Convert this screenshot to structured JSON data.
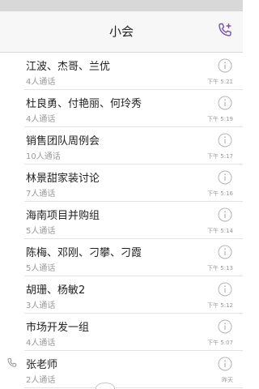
{
  "header": {
    "title": "小会"
  },
  "icons": {
    "new_call": "phone-plus-icon",
    "info": "info-circle-icon",
    "phone": "phone-icon"
  },
  "colors": {
    "accent": "#7b4fa6",
    "icon_gray": "#b5b5b5"
  },
  "calls": [
    {
      "title": "江波、杰哥、兰优",
      "sub": "4人通话",
      "time": "下午 5:21"
    },
    {
      "title": "杜良勇、付艳丽、何玲秀",
      "sub": "4人通话",
      "time": "下午 5:19"
    },
    {
      "title": "销售团队周例会",
      "sub": "10人通话",
      "time": "下午 5:17"
    },
    {
      "title": "林景甜家装讨论",
      "sub": "7人通话",
      "time": "下午 5:16"
    },
    {
      "title": "海南项目并购组",
      "sub": "5人通话",
      "time": "下午 5:14"
    },
    {
      "title": "陈梅、邓刚、刁攀、刁霞",
      "sub": "5人通话",
      "time": "下午 5:13"
    },
    {
      "title": "胡珊、杨敏2",
      "sub": "3人通话",
      "time": "下午 5:12"
    },
    {
      "title": "市场开发一组",
      "sub": "4人通话",
      "time": "下午 5:07"
    },
    {
      "title": "张老师",
      "sub": "2人通话",
      "time": "昨天"
    }
  ]
}
